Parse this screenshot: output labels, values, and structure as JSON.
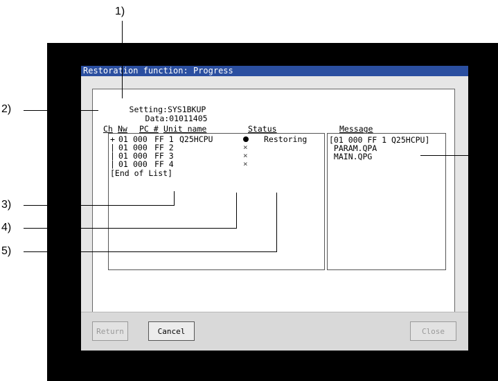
{
  "callouts": {
    "c1": "1)",
    "c2": "2)",
    "c3": "3)",
    "c4": "4)",
    "c5": "5)"
  },
  "dialog": {
    "title": "Restoration function: Progress",
    "setting_label": "Setting:",
    "setting_value": "SYS1BKUP",
    "data_label": "Data:",
    "data_value": "01011405"
  },
  "list": {
    "headers": {
      "ch": "Ch",
      "nw": "Nw",
      "pc": "PC #",
      "unit": "Unit name",
      "status": "Status"
    },
    "rows": [
      {
        "prefix": "+",
        "ch": "01",
        "nw": "000",
        "pc": "FF 1",
        "unit": "Q25HCPU",
        "state": "processing",
        "status": "Restoring"
      },
      {
        "prefix": "|",
        "ch": "01",
        "nw": "000",
        "pc": "FF 2",
        "unit": "",
        "state": "unprocessed",
        "status": ""
      },
      {
        "prefix": "|",
        "ch": "01",
        "nw": "000",
        "pc": "FF 3",
        "unit": "",
        "state": "unprocessed",
        "status": ""
      },
      {
        "prefix": "|",
        "ch": "01",
        "nw": "000",
        "pc": "FF 4",
        "unit": "",
        "state": "unprocessed",
        "status": ""
      }
    ],
    "end_text": "[End of List]",
    "state_symbols": {
      "processing": "●",
      "unprocessed": "×"
    }
  },
  "message": {
    "header": "Message",
    "lines": [
      "[01 000 FF 1 Q25HCPU]",
      " PARAM.QPA",
      " MAIN.QPG"
    ]
  },
  "buttons": {
    "return_label": "Return",
    "cancel_label": "Cancel",
    "close_label": "Close"
  }
}
